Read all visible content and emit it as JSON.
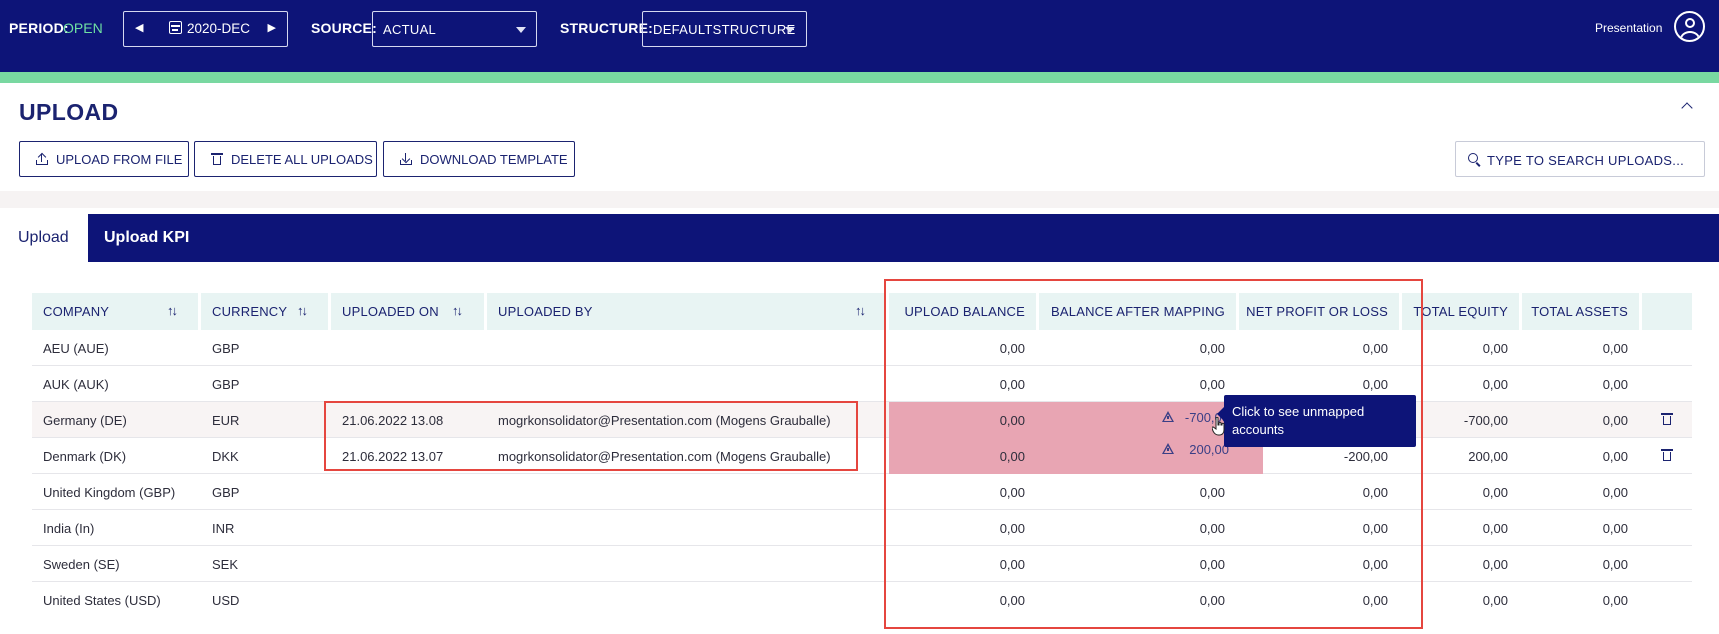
{
  "header": {
    "period_label": "PERIOD:",
    "period_status": "OPEN",
    "period_value": "2020-DEC",
    "source_label": "SOURCE:",
    "source_value": "ACTUAL",
    "structure_label": "STRUCTURE:",
    "structure_value": "DEFAULTSTRUCTURE",
    "user_name": "Presentation"
  },
  "colors": {
    "header_bg": "#0d1478",
    "accent_green": "#79d8a1",
    "status_open": "#6fe0a3",
    "error_cell": "#e8a5b3",
    "annotation_red": "#e5463f",
    "table_header_bg": "#e8f4f3"
  },
  "panel": {
    "title": "UPLOAD",
    "buttons": {
      "upload_from_file": "UPLOAD FROM FILE",
      "delete_all_uploads": "DELETE ALL UPLOADS",
      "download_template": "DOWNLOAD TEMPLATE"
    },
    "search_placeholder": "TYPE TO SEARCH UPLOADS..."
  },
  "tabs": [
    {
      "label": "Upload",
      "active": true
    },
    {
      "label": "Upload KPI",
      "active": false
    }
  ],
  "table": {
    "columns": {
      "company": "COMPANY",
      "currency": "CURRENCY",
      "uploaded_on": "UPLOADED ON",
      "uploaded_by": "UPLOADED BY",
      "upload_balance": "UPLOAD BALANCE",
      "balance_after_mapping": "BALANCE AFTER MAPPING",
      "net_profit_or_loss": "NET PROFIT OR LOSS",
      "total_equity": "TOTAL EQUITY",
      "total_assets": "TOTAL ASSETS"
    },
    "sort_glyph": "↑↓",
    "rows": [
      {
        "company": "AEU (AUE)",
        "currency": "GBP",
        "uploaded_on": "",
        "uploaded_by": "",
        "upload_balance": "0,00",
        "balance_after_mapping": "0,00",
        "net_profit_or_loss": "0,00",
        "total_equity": "0,00",
        "total_assets": "0,00"
      },
      {
        "company": "AUK (AUK)",
        "currency": "GBP",
        "uploaded_on": "",
        "uploaded_by": "",
        "upload_balance": "0,00",
        "balance_after_mapping": "0,00",
        "net_profit_or_loss": "0,00",
        "total_equity": "0,00",
        "total_assets": "0,00"
      },
      {
        "company": "Germany (DE)",
        "currency": "EUR",
        "uploaded_on": "21.06.2022 13.08",
        "uploaded_by": "mogrkonsolidator@Presentation.com (Mogens Grauballe)",
        "upload_balance": "0,00",
        "balance_after_mapping": "-700,00",
        "net_profit_or_loss": "",
        "total_equity": "-700,00",
        "total_assets": "0,00"
      },
      {
        "company": "Denmark (DK)",
        "currency": "DKK",
        "uploaded_on": "21.06.2022 13.07",
        "uploaded_by": "mogrkonsolidator@Presentation.com (Mogens Grauballe)",
        "upload_balance": "0,00",
        "balance_after_mapping": "200,00",
        "net_profit_or_loss": "-200,00",
        "total_equity": "200,00",
        "total_assets": "0,00"
      },
      {
        "company": "United Kingdom (GBP)",
        "currency": "GBP",
        "uploaded_on": "",
        "uploaded_by": "",
        "upload_balance": "0,00",
        "balance_after_mapping": "0,00",
        "net_profit_or_loss": "0,00",
        "total_equity": "0,00",
        "total_assets": "0,00"
      },
      {
        "company": "India (In)",
        "currency": "INR",
        "uploaded_on": "",
        "uploaded_by": "",
        "upload_balance": "0,00",
        "balance_after_mapping": "0,00",
        "net_profit_or_loss": "0,00",
        "total_equity": "0,00",
        "total_assets": "0,00"
      },
      {
        "company": "Sweden (SE)",
        "currency": "SEK",
        "uploaded_on": "",
        "uploaded_by": "",
        "upload_balance": "0,00",
        "balance_after_mapping": "0,00",
        "net_profit_or_loss": "0,00",
        "total_equity": "0,00",
        "total_assets": "0,00"
      },
      {
        "company": "United States (USD)",
        "currency": "USD",
        "uploaded_on": "",
        "uploaded_by": "",
        "upload_balance": "0,00",
        "balance_after_mapping": "0,00",
        "net_profit_or_loss": "0,00",
        "total_equity": "0,00",
        "total_assets": "0,00"
      }
    ]
  },
  "tooltip": {
    "text": "Click to see unmapped accounts"
  }
}
